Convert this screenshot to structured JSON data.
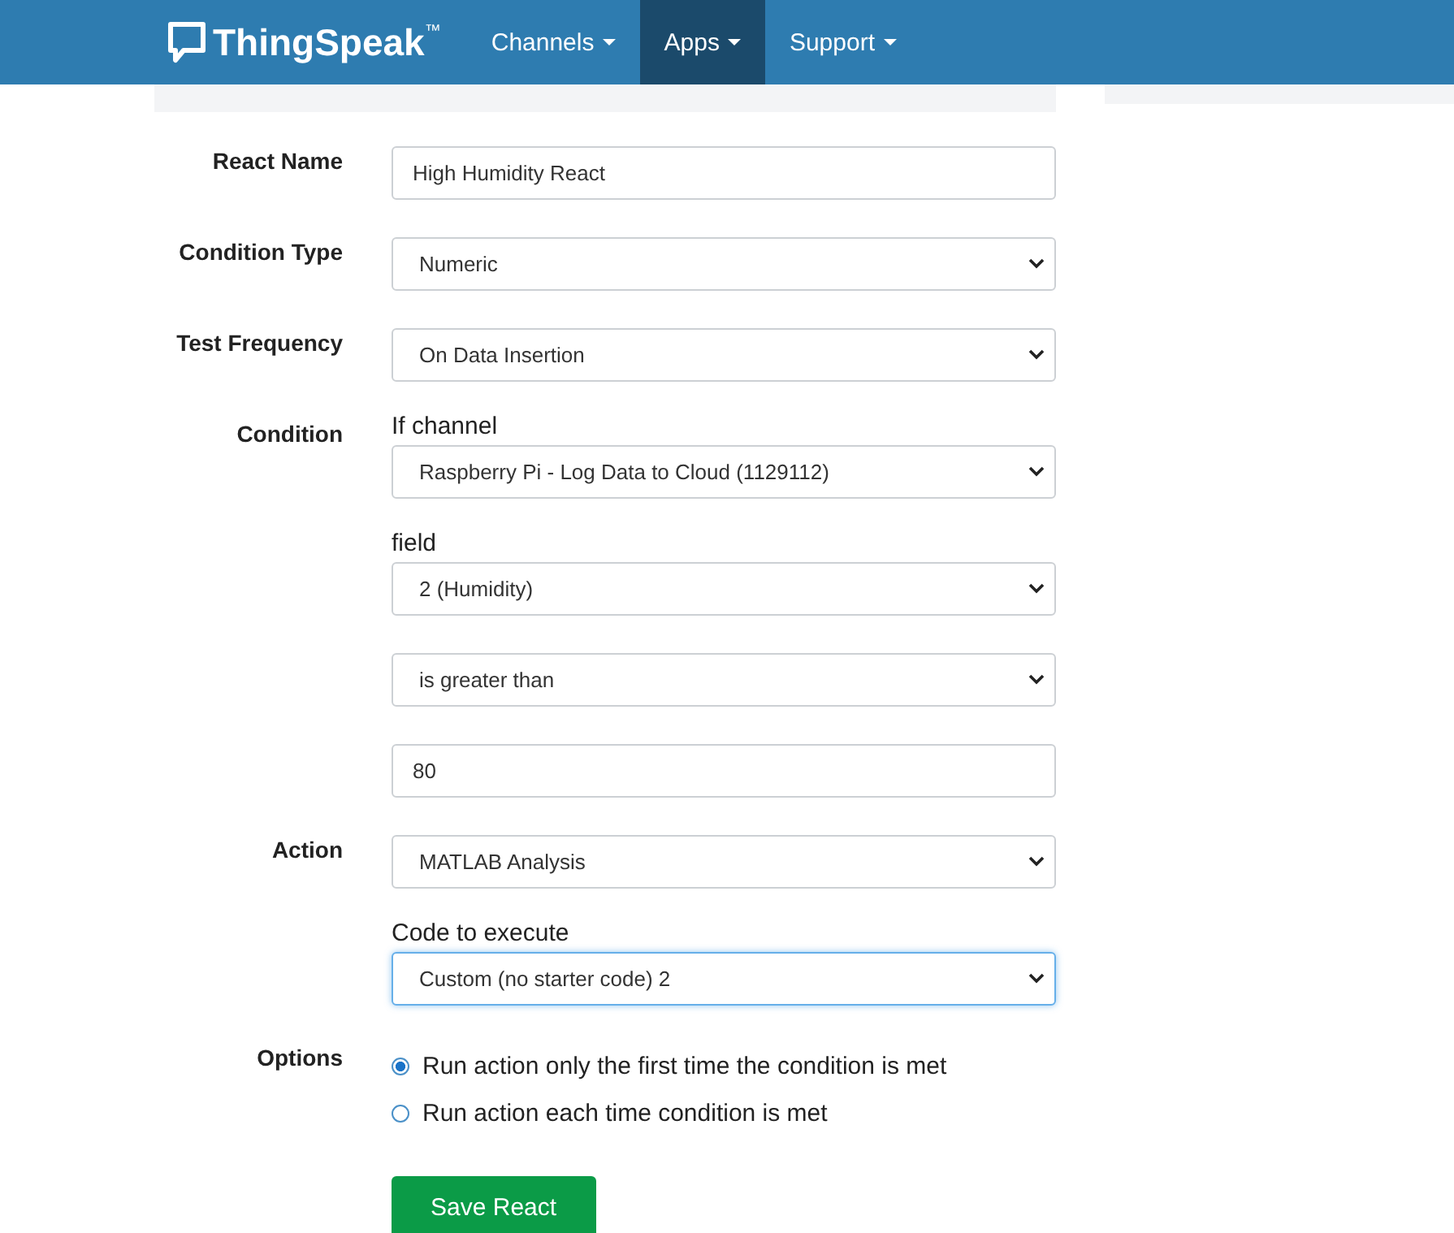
{
  "navbar": {
    "brand": "ThingSpeak",
    "trademark": "™",
    "items": [
      {
        "label": "Channels",
        "selected": false
      },
      {
        "label": "Apps",
        "selected": true
      },
      {
        "label": "Support",
        "selected": false
      }
    ]
  },
  "form": {
    "rows": [
      {
        "label": "React Name",
        "controls": [
          {
            "kind": "input",
            "value": "High Humidity React"
          }
        ]
      },
      {
        "label": "Condition Type",
        "controls": [
          {
            "kind": "select",
            "value": "Numeric",
            "focused": false
          }
        ]
      },
      {
        "label": "Test Frequency",
        "controls": [
          {
            "kind": "select",
            "value": "On Data Insertion",
            "focused": false
          }
        ]
      },
      {
        "label": "Condition",
        "controls": [
          {
            "kind": "select",
            "caption": "If channel",
            "value": "Raspberry Pi - Log Data to Cloud (1129112)",
            "focused": false
          },
          {
            "kind": "select",
            "caption": "field",
            "value": "2 (Humidity)",
            "focused": false
          },
          {
            "kind": "select",
            "value": "is greater than",
            "focused": false
          },
          {
            "kind": "input",
            "value": "80"
          }
        ]
      },
      {
        "label": "Action",
        "controls": [
          {
            "kind": "select",
            "value": "MATLAB Analysis",
            "focused": false
          },
          {
            "kind": "select",
            "caption": "Code to execute",
            "value": "Custom (no starter code) 2",
            "focused": true
          }
        ]
      }
    ],
    "options": {
      "label": "Options",
      "choices": [
        {
          "label": "Run action only the first time the condition is met",
          "selected": true
        },
        {
          "label": "Run action each time condition is met",
          "selected": false
        }
      ]
    },
    "submit": "Save React"
  }
}
